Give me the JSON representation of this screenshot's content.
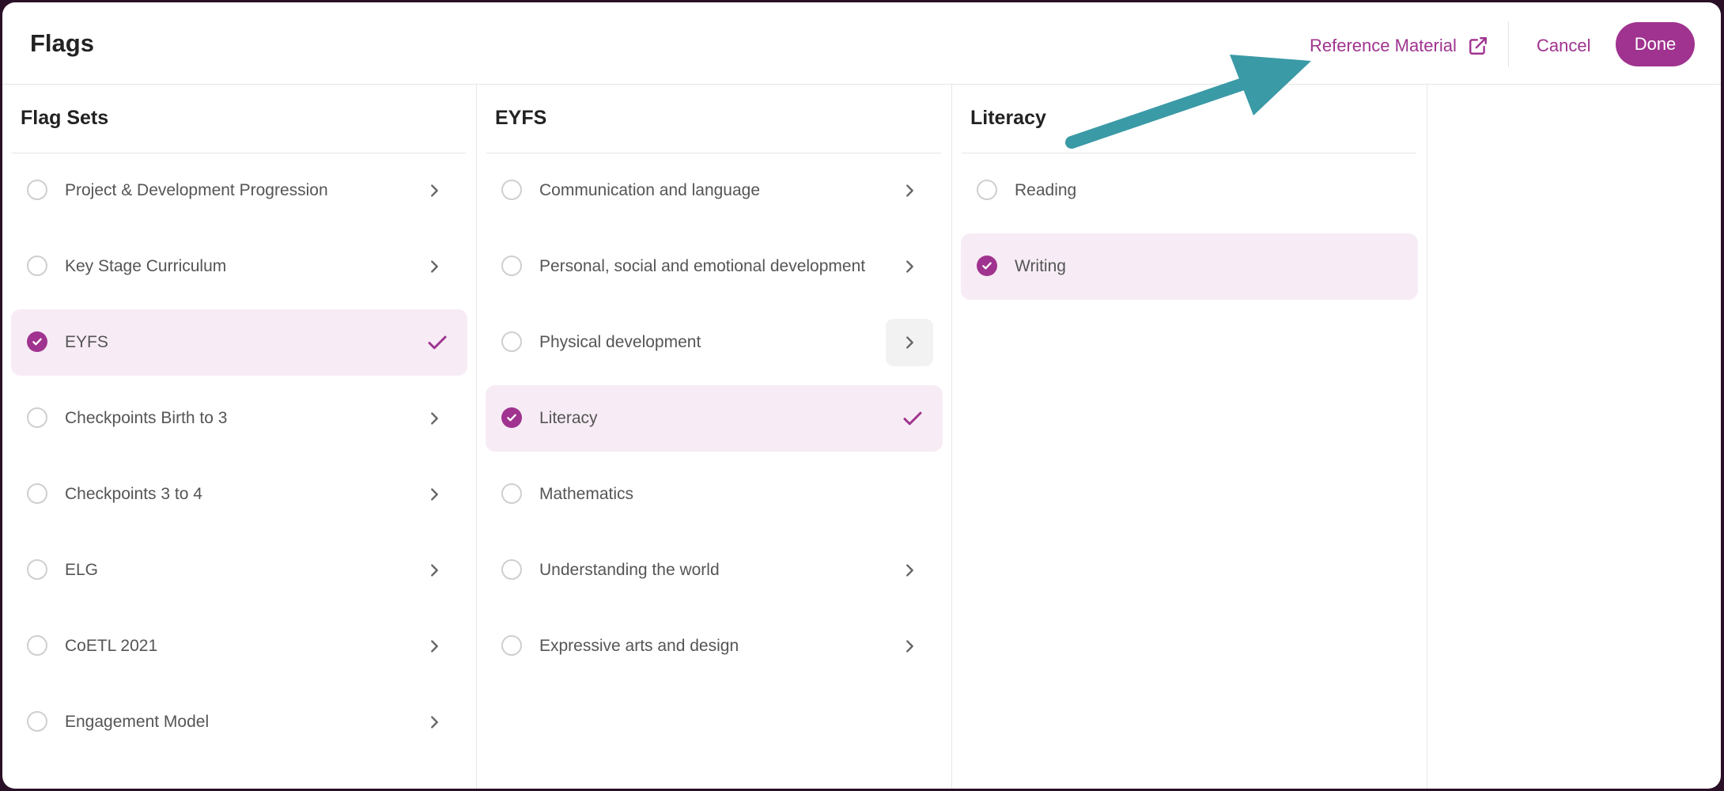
{
  "header": {
    "title": "Flags",
    "reference_label": "Reference Material",
    "cancel_label": "Cancel",
    "done_label": "Done"
  },
  "columns": [
    {
      "title": "Flag Sets",
      "items": [
        {
          "label": "Project & Development Progression",
          "checked": false,
          "has_children": true
        },
        {
          "label": "Key Stage Curriculum",
          "checked": false,
          "has_children": true
        },
        {
          "label": "EYFS",
          "checked": true,
          "has_children": true
        },
        {
          "label": "Checkpoints Birth to 3",
          "checked": false,
          "has_children": true
        },
        {
          "label": "Checkpoints 3 to 4",
          "checked": false,
          "has_children": true
        },
        {
          "label": "ELG",
          "checked": false,
          "has_children": true
        },
        {
          "label": "CoETL 2021",
          "checked": false,
          "has_children": true
        },
        {
          "label": "Engagement Model",
          "checked": false,
          "has_children": true
        }
      ]
    },
    {
      "title": "EYFS",
      "items": [
        {
          "label": "Communication and language",
          "checked": false,
          "has_children": true
        },
        {
          "label": "Personal, social and emotional development",
          "checked": false,
          "has_children": true
        },
        {
          "label": "Physical development",
          "checked": false,
          "has_children": true
        },
        {
          "label": "Literacy",
          "checked": true,
          "has_children": true
        },
        {
          "label": "Mathematics",
          "checked": false,
          "has_children": false
        },
        {
          "label": "Understanding the world",
          "checked": false,
          "has_children": true
        },
        {
          "label": "Expressive arts and design",
          "checked": false,
          "has_children": true
        }
      ]
    },
    {
      "title": "Literacy",
      "items": [
        {
          "label": "Reading",
          "checked": false,
          "has_children": false
        },
        {
          "label": "Writing",
          "checked": true,
          "has_children": false
        }
      ]
    }
  ],
  "colors": {
    "accent": "#a0338f",
    "selected_bg": "#f7ecf5",
    "annotation_arrow": "#3a9aa6"
  },
  "icons": {
    "external_link": "external-link-icon",
    "chevron": "chevron-right-icon",
    "check": "check-icon"
  }
}
